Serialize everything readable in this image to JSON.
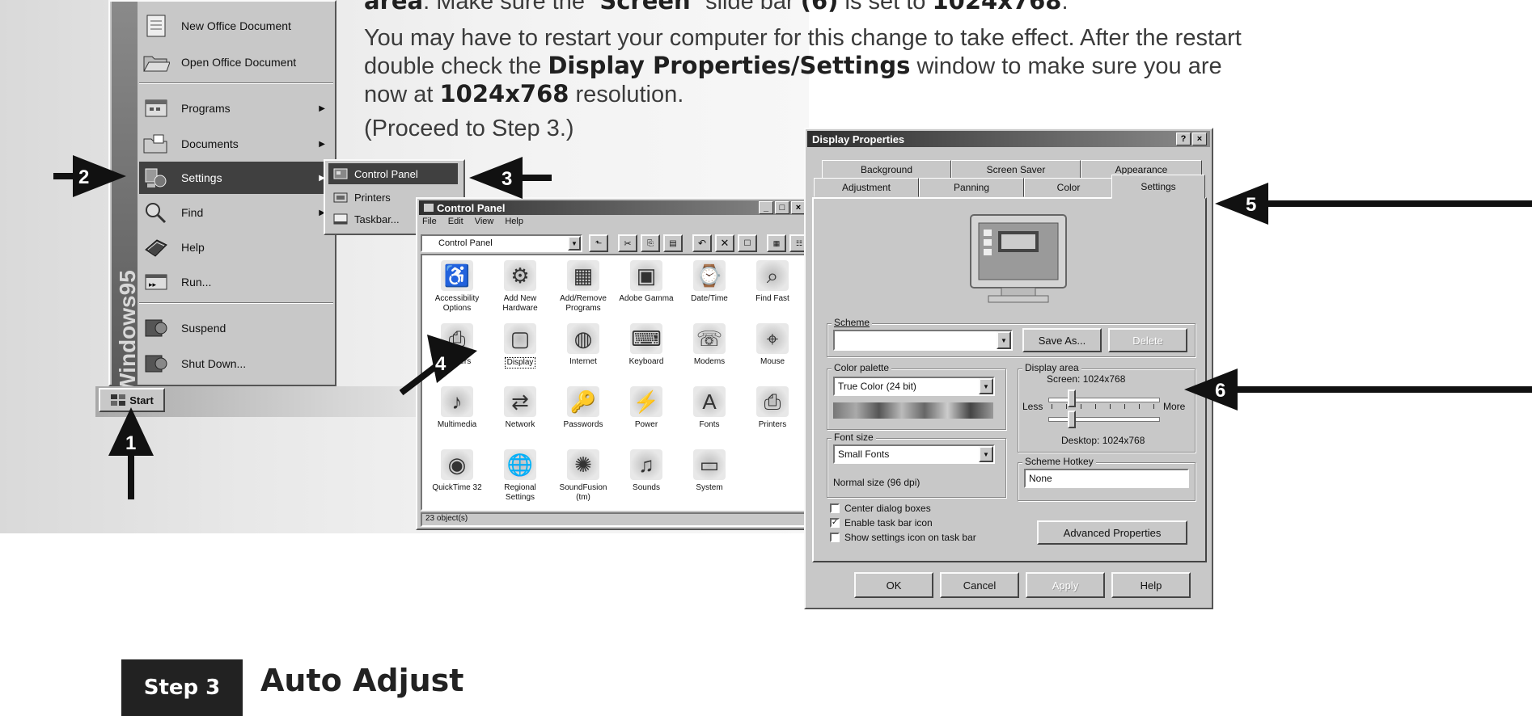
{
  "instructions": {
    "line1_pre": "area",
    "line1_mid": ". Make sure the \"",
    "line1_screen": "Screen",
    "line1_mid2": "\" slide bar ",
    "line1_num": "(6)",
    "line1_mid3": " is set to ",
    "line1_res": "1024x768",
    "line1_end": ".",
    "p2_a": "You may have to restart your computer for this change to take effect. After the restart",
    "p2_b": "double check the ",
    "p2_bold": "Display Properties/Settings",
    "p2_c": " window to make sure you are",
    "p2_d": "now at ",
    "p2_res": "1024x768",
    "p2_e": " resolution.",
    "proceed": "(Proceed to Step 3.)"
  },
  "step3": {
    "badge": "Step 3",
    "title": "Auto Adjust"
  },
  "start_menu": {
    "banner": "Windows95",
    "top_items": [
      "New Office Document",
      "Open Office Document"
    ],
    "items": [
      "Programs",
      "Documents",
      "Settings",
      "Find",
      "Help",
      "Run...",
      "Suspend",
      "Shut Down..."
    ],
    "start_label": "Start",
    "submenu": [
      "Control Panel",
      "Printers",
      "Taskbar..."
    ]
  },
  "control_panel": {
    "title": "Control Panel",
    "menu": [
      "File",
      "Edit",
      "View",
      "Help"
    ],
    "address": "Control Panel",
    "icons": [
      [
        "Accessibility",
        "Options"
      ],
      [
        "Add New",
        "Hardware"
      ],
      [
        "Add/Remove",
        "Programs"
      ],
      [
        "Adobe Gamma",
        ""
      ],
      [
        "Date/Time",
        ""
      ],
      [
        "Find Fast",
        ""
      ],
      [
        "Printers",
        ""
      ],
      [
        "Display",
        ""
      ],
      [
        "Internet",
        ""
      ],
      [
        "Keyboard",
        ""
      ],
      [
        "Modems",
        ""
      ],
      [
        "Mouse",
        ""
      ],
      [
        "Multimedia",
        ""
      ],
      [
        "Network",
        ""
      ],
      [
        "Passwords",
        ""
      ],
      [
        "Power",
        ""
      ],
      [
        "Fonts",
        ""
      ],
      [
        "Printers",
        ""
      ],
      [
        "QuickTime 32",
        ""
      ],
      [
        "Regional",
        "Settings"
      ],
      [
        "SoundFusion",
        "(tm)"
      ],
      [
        "Sounds",
        ""
      ],
      [
        "System",
        ""
      ]
    ],
    "status": "23 object(s)"
  },
  "display_props": {
    "title": "Display Properties",
    "tabs_row1": [
      "Background",
      "Screen Saver",
      "Appearance"
    ],
    "tabs_row2": [
      "Adjustment",
      "Panning",
      "Color",
      "Settings"
    ],
    "scheme_label": "Scheme",
    "save_as": "Save As...",
    "delete": "Delete",
    "color_palette_label": "Color palette",
    "color_palette_value": "True Color (24 bit)",
    "display_area_label": "Display area",
    "screen_text": "Screen: 1024x768",
    "less": "Less",
    "more": "More",
    "desktop_text": "Desktop: 1024x768",
    "font_size_label": "Font size",
    "font_size_value": "Small Fonts",
    "normal_size": "Normal size (96 dpi)",
    "scheme_hotkey_label": "Scheme Hotkey",
    "scheme_hotkey_value": "None",
    "checkboxes": [
      {
        "label": "Center dialog boxes",
        "checked": false
      },
      {
        "label": "Enable task bar icon",
        "checked": true
      },
      {
        "label": "Show settings icon on task bar",
        "checked": false
      }
    ],
    "advanced": "Advanced Properties",
    "buttons": [
      "OK",
      "Cancel",
      "Apply",
      "Help"
    ]
  },
  "callouts": [
    "1",
    "2",
    "3",
    "4",
    "5",
    "6"
  ]
}
